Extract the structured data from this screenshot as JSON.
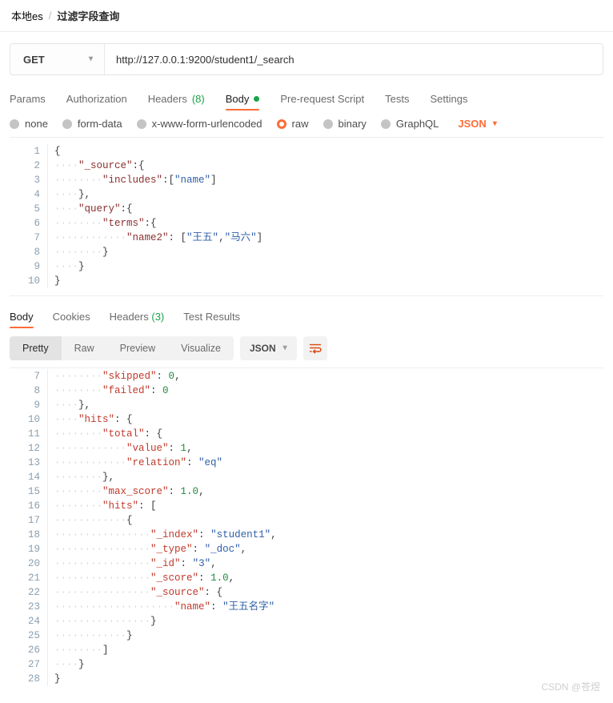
{
  "breadcrumb": {
    "root": "本地es",
    "separator": "/",
    "current": "过滤字段查询"
  },
  "request": {
    "method": "GET",
    "url": "http://127.0.0.1:9200/student1/_search",
    "tabs": [
      {
        "label": "Params",
        "active": false
      },
      {
        "label": "Authorization",
        "active": false
      },
      {
        "label": "Headers",
        "count": "(8)",
        "active": false
      },
      {
        "label": "Body",
        "dot": true,
        "active": true
      },
      {
        "label": "Pre-request Script",
        "active": false
      },
      {
        "label": "Tests",
        "active": false
      },
      {
        "label": "Settings",
        "active": false
      }
    ],
    "body_types": [
      {
        "label": "none",
        "selected": false
      },
      {
        "label": "form-data",
        "selected": false
      },
      {
        "label": "x-www-form-urlencoded",
        "selected": false
      },
      {
        "label": "raw",
        "selected": true
      },
      {
        "label": "binary",
        "selected": false
      },
      {
        "label": "GraphQL",
        "selected": false
      }
    ],
    "body_format": "JSON",
    "body_lines": [
      {
        "n": "1",
        "text": "{"
      },
      {
        "n": "2",
        "text": "    \"_source\":{"
      },
      {
        "n": "3",
        "text": "        \"includes\":[\"name\"]"
      },
      {
        "n": "4",
        "text": "    },"
      },
      {
        "n": "5",
        "text": "    \"query\":{"
      },
      {
        "n": "6",
        "text": "        \"terms\":{"
      },
      {
        "n": "7",
        "text": "            \"name2\": [\"王五\",\"马六\"]"
      },
      {
        "n": "8",
        "text": "        }"
      },
      {
        "n": "9",
        "text": "    }"
      },
      {
        "n": "10",
        "text": "}"
      }
    ]
  },
  "response": {
    "tabs": [
      {
        "label": "Body",
        "active": true
      },
      {
        "label": "Cookies",
        "active": false
      },
      {
        "label": "Headers",
        "count": "(3)",
        "active": false
      },
      {
        "label": "Test Results",
        "active": false
      }
    ],
    "view_modes": [
      {
        "label": "Pretty",
        "active": true
      },
      {
        "label": "Raw",
        "active": false
      },
      {
        "label": "Preview",
        "active": false
      },
      {
        "label": "Visualize",
        "active": false
      }
    ],
    "format": "JSON",
    "wrap_icon": "word-wrap-icon",
    "body_lines": [
      {
        "n": "7",
        "text": "        \"skipped\": 0,"
      },
      {
        "n": "8",
        "text": "        \"failed\": 0"
      },
      {
        "n": "9",
        "text": "    },"
      },
      {
        "n": "10",
        "text": "    \"hits\": {"
      },
      {
        "n": "11",
        "text": "        \"total\": {"
      },
      {
        "n": "12",
        "text": "            \"value\": 1,"
      },
      {
        "n": "13",
        "text": "            \"relation\": \"eq\""
      },
      {
        "n": "14",
        "text": "        },"
      },
      {
        "n": "15",
        "text": "        \"max_score\": 1.0,"
      },
      {
        "n": "16",
        "text": "        \"hits\": ["
      },
      {
        "n": "17",
        "text": "            {"
      },
      {
        "n": "18",
        "text": "                \"_index\": \"student1\","
      },
      {
        "n": "19",
        "text": "                \"_type\": \"_doc\","
      },
      {
        "n": "20",
        "text": "                \"_id\": \"3\","
      },
      {
        "n": "21",
        "text": "                \"_score\": 1.0,"
      },
      {
        "n": "22",
        "text": "                \"_source\": {"
      },
      {
        "n": "23",
        "text": "                    \"name\": \"王五名字\""
      },
      {
        "n": "24",
        "text": "                }"
      },
      {
        "n": "25",
        "text": "            }"
      },
      {
        "n": "26",
        "text": "        ]"
      },
      {
        "n": "27",
        "text": "    }"
      },
      {
        "n": "28",
        "text": "}"
      }
    ]
  },
  "watermark": "CSDN @苍煜",
  "colors": {
    "accent": "#ff6c37",
    "green": "#1aa34a",
    "key_request": "#8b2f2f",
    "key_response": "#c0392b",
    "string": "#2f5fa8",
    "number": "#1f8a3c"
  }
}
